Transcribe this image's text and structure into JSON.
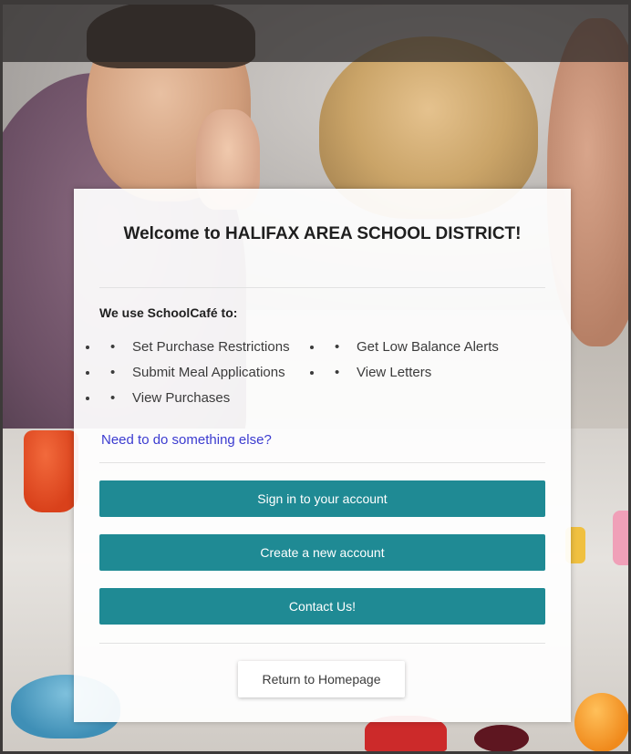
{
  "card": {
    "title": "Welcome to HALIFAX AREA SCHOOL DISTRICT!",
    "intro": "We use SchoolCafé to:",
    "features": [
      "Set Purchase Restrictions",
      "Submit Meal Applications",
      "View Purchases",
      "Get Low Balance Alerts",
      "View Letters"
    ],
    "help_link": "Need to do something else?",
    "buttons": {
      "sign_in": "Sign in to your account",
      "create_account": "Create a new account",
      "contact": "Contact Us!",
      "return_home": "Return to Homepage"
    }
  },
  "colors": {
    "primary_button": "#1f8a94",
    "link": "#3b3bd0",
    "card_background": "#ffffff"
  }
}
